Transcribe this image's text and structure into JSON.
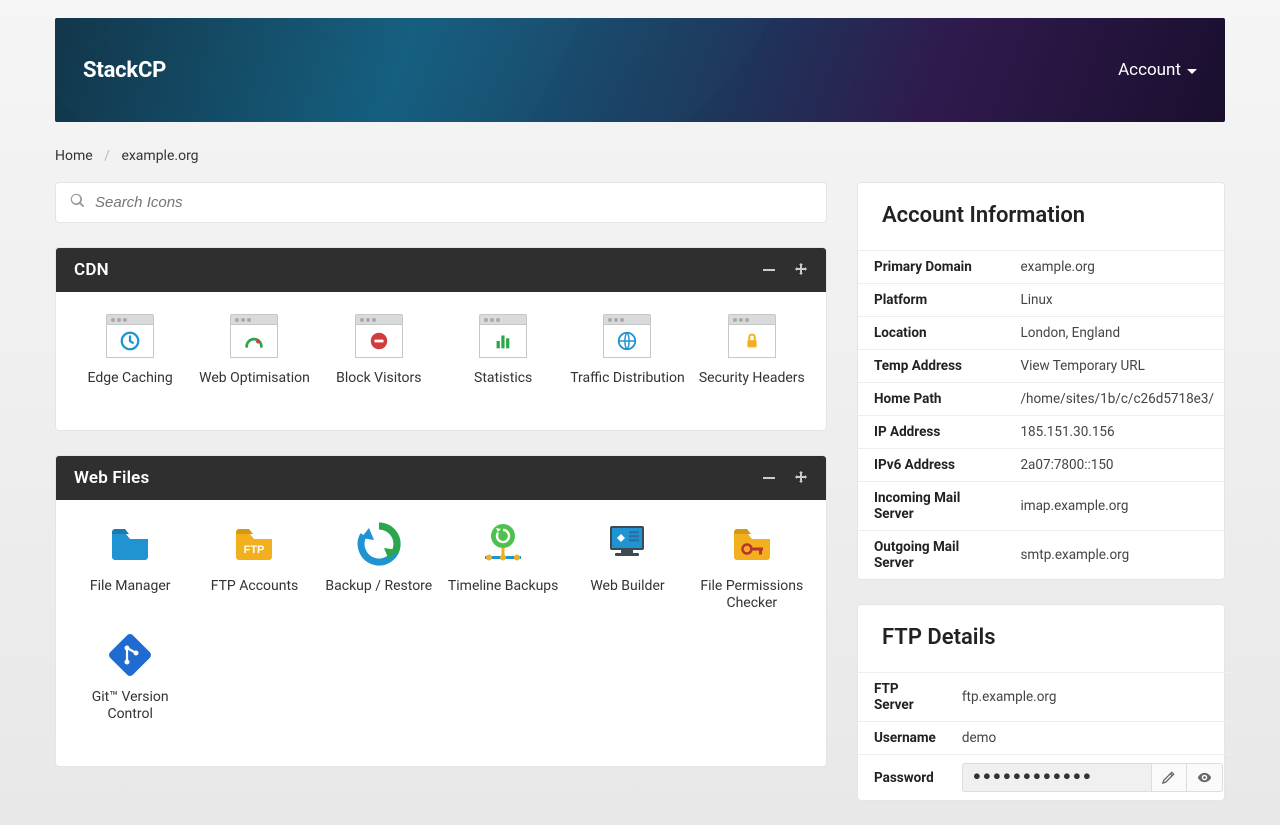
{
  "header": {
    "brand": "StackCP",
    "account_label": "Account"
  },
  "breadcrumb": {
    "home": "Home",
    "current": "example.org"
  },
  "search": {
    "placeholder": "Search Icons"
  },
  "panels": {
    "cdn": {
      "title": "CDN",
      "items": [
        {
          "label": "Edge Caching"
        },
        {
          "label": "Web Optimisation"
        },
        {
          "label": "Block Visitors"
        },
        {
          "label": "Statistics"
        },
        {
          "label": "Traffic Distribution"
        },
        {
          "label": "Security Headers"
        }
      ]
    },
    "webfiles": {
      "title": "Web Files",
      "items": [
        {
          "label": "File Manager"
        },
        {
          "label": "FTP Accounts"
        },
        {
          "label": "Backup / Restore"
        },
        {
          "label": "Timeline Backups"
        },
        {
          "label": "Web Builder"
        },
        {
          "label": "File Permissions Checker"
        },
        {
          "label": "Git™ Version Control"
        }
      ]
    }
  },
  "account_info": {
    "title": "Account Information",
    "rows": [
      {
        "k": "Primary Domain",
        "v": "example.org"
      },
      {
        "k": "Platform",
        "v": "Linux"
      },
      {
        "k": "Location",
        "v": "London, England"
      },
      {
        "k": "Temp Address",
        "v": "View Temporary URL"
      },
      {
        "k": "Home Path",
        "v": "/home/sites/1b/c/c26d5718e3/"
      },
      {
        "k": "IP Address",
        "v": "185.151.30.156"
      },
      {
        "k": "IPv6 Address",
        "v": "2a07:7800::150"
      },
      {
        "k": "Incoming Mail Server",
        "v": "imap.example.org"
      },
      {
        "k": "Outgoing Mail Server",
        "v": "smtp.example.org"
      }
    ]
  },
  "ftp": {
    "title": "FTP Details",
    "server_k": "FTP Server",
    "server_v": "ftp.example.org",
    "user_k": "Username",
    "user_v": "demo",
    "pass_k": "Password",
    "pass_v": "●●●●●●●●●●●●"
  }
}
